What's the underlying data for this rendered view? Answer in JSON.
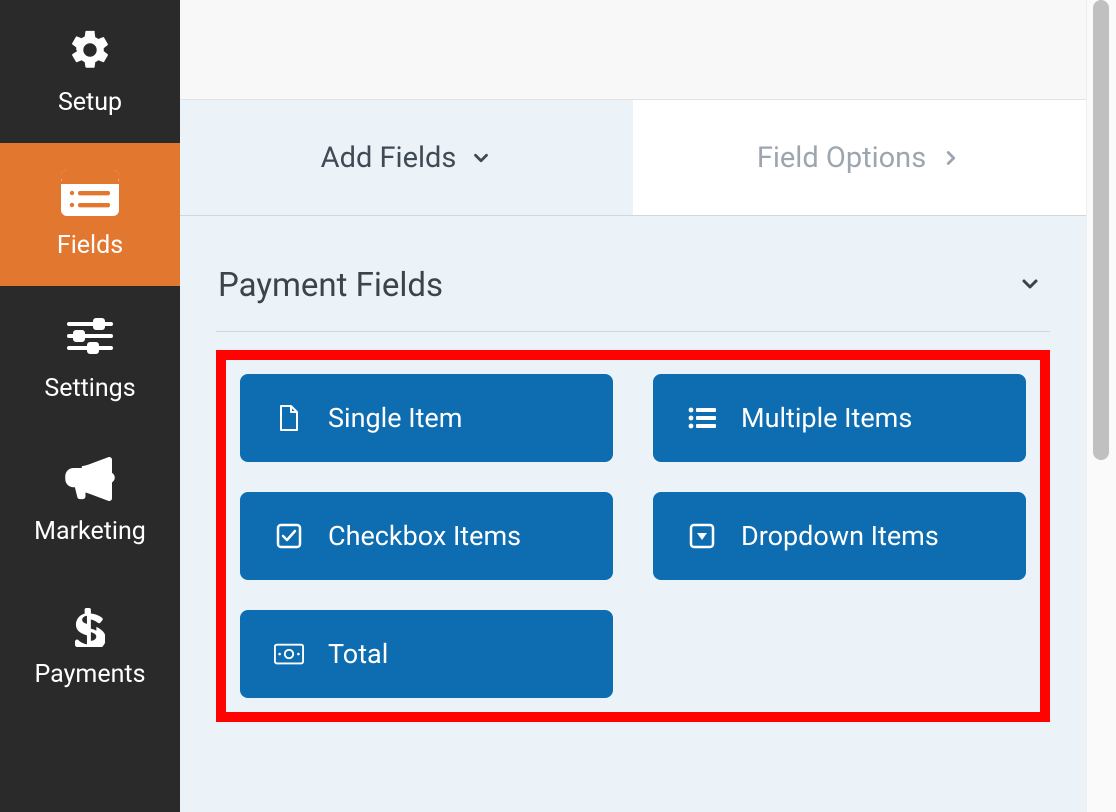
{
  "sidebar": {
    "items": [
      {
        "label": "Setup",
        "icon": "gear-icon",
        "active": false
      },
      {
        "label": "Fields",
        "icon": "form-icon",
        "active": true
      },
      {
        "label": "Settings",
        "icon": "sliders-icon",
        "active": false
      },
      {
        "label": "Marketing",
        "icon": "bullhorn-icon",
        "active": false
      },
      {
        "label": "Payments",
        "icon": "dollar-icon",
        "active": false
      }
    ]
  },
  "tabs": {
    "add_fields": {
      "label": "Add Fields"
    },
    "field_options": {
      "label": "Field Options"
    }
  },
  "section": {
    "title": "Payment Fields"
  },
  "fields": [
    {
      "label": "Single Item",
      "icon": "file-icon"
    },
    {
      "label": "Multiple Items",
      "icon": "list-icon"
    },
    {
      "label": "Checkbox Items",
      "icon": "checkbox-icon"
    },
    {
      "label": "Dropdown Items",
      "icon": "caret-square-icon"
    },
    {
      "label": "Total",
      "icon": "money-icon"
    }
  ],
  "colors": {
    "accent": "#e27730",
    "button": "#0e6cb0",
    "highlight_border": "#ff0202"
  }
}
